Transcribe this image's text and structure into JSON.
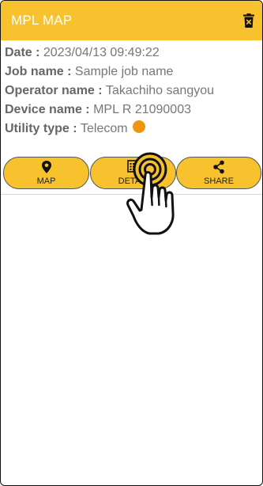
{
  "appbar": {
    "title": "MPL MAP",
    "delete_icon": "trash-icon"
  },
  "info": {
    "date_label": "Date : ",
    "date_value": "2023/04/13 09:49:22",
    "job_label": "Job name : ",
    "job_value": "Sample job name",
    "operator_label": "Operator name : ",
    "operator_value": "Takachiho sangyou",
    "device_label": "Device name : ",
    "device_value": "MPL R 21090003",
    "utility_label": "Utility type : ",
    "utility_value": "Telecom",
    "utility_color": "#f0950e"
  },
  "actions": {
    "map_label": "MAP",
    "map_icon": "map-pin-icon",
    "detail_label": "DETAIL",
    "detail_icon": "list-icon",
    "share_label": "SHARE",
    "share_icon": "share-icon"
  },
  "colors": {
    "accent": "#f8c22e",
    "text": "#777777"
  }
}
